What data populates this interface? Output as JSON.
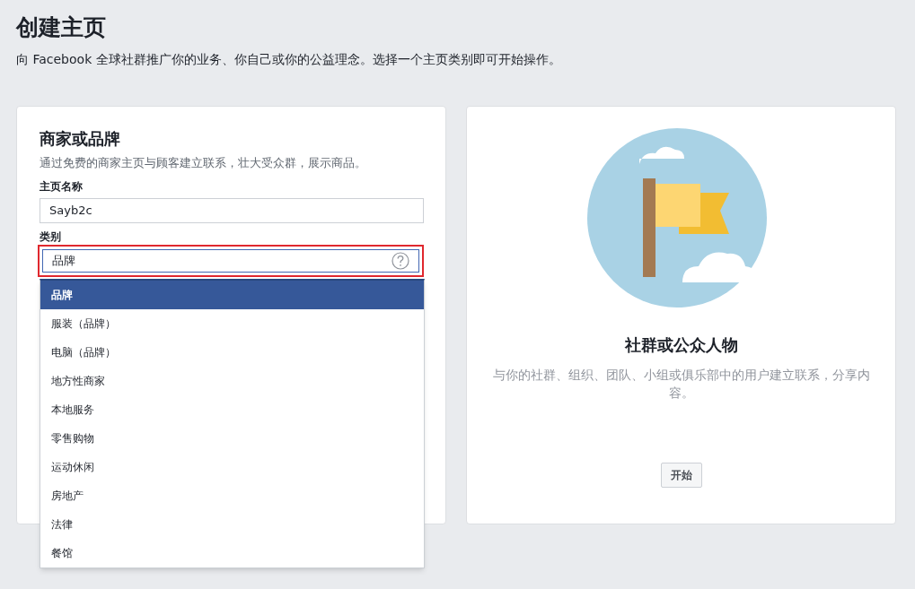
{
  "page": {
    "title": "创建主页",
    "subtitle": "向 Facebook 全球社群推广你的业务、你自己或你的公益理念。选择一个主页类别即可开始操作。"
  },
  "business_card": {
    "title": "商家或品牌",
    "description": "通过免费的商家主页与顾客建立联系，壮大受众群，展示商品。",
    "page_name": {
      "label": "主页名称",
      "value": "Sayb2c"
    },
    "category": {
      "label": "类别",
      "value": "品牌",
      "highlighted": true,
      "expanded": true
    },
    "options": [
      {
        "label": "品牌",
        "selected": true
      },
      {
        "label": "服装（品牌）",
        "selected": false
      },
      {
        "label": "电脑（品牌）",
        "selected": false
      },
      {
        "label": "地方性商家",
        "selected": false
      },
      {
        "label": "本地服务",
        "selected": false
      },
      {
        "label": "零售购物",
        "selected": false
      },
      {
        "label": "运动休闲",
        "selected": false
      },
      {
        "label": "房地产",
        "selected": false
      },
      {
        "label": "法律",
        "selected": false
      },
      {
        "label": "餐馆",
        "selected": false
      }
    ]
  },
  "community_card": {
    "title": "社群或公众人物",
    "description": "与你的社群、组织、团队、小组或俱乐部中的用户建立联系，分享内容。",
    "button": "开始"
  }
}
